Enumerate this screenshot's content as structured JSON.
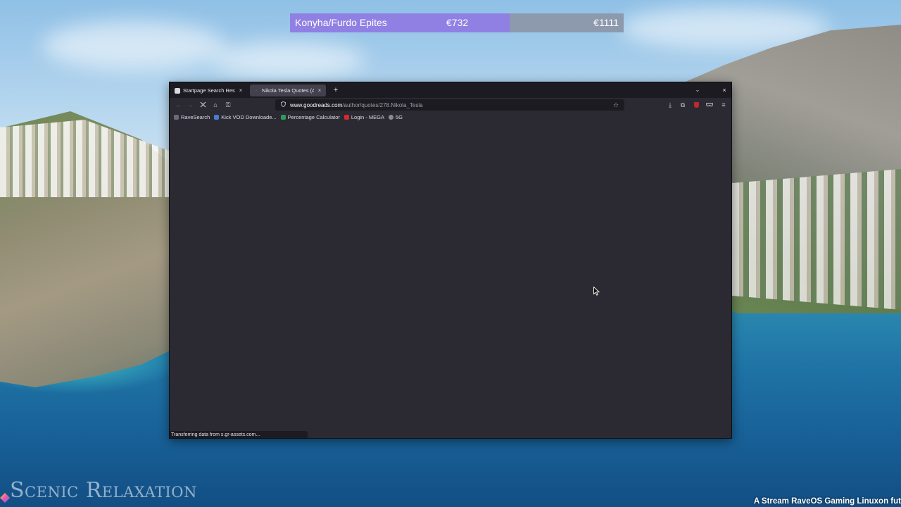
{
  "goal_bar": {
    "label": "Konyha/Furdo Epites",
    "current": "€732",
    "target": "€1111",
    "progress_fraction": 0.659,
    "fill_color": "#9080e4"
  },
  "browser": {
    "tabs": [
      {
        "title": "Startpage Search Results",
        "icon": "startpage-favicon",
        "active": false,
        "close": "×"
      },
      {
        "title": "Nikola Tesla Quotes (Author of My Inventions)",
        "icon": "loading-icon",
        "active": true,
        "close": "×"
      }
    ],
    "new_tab": "+",
    "list_tabs": "⌄",
    "close_window": "×",
    "nav": {
      "back": "←",
      "forward": "→",
      "home": "⌂",
      "permissions": "⚿",
      "star": "☆",
      "downloads": "⤓",
      "extensions": "⧉",
      "menu": "≡"
    },
    "url": {
      "host": "www.goodreads.com",
      "path": "/author/quotes/278.Nikola_Tesla"
    },
    "bookmarks": [
      {
        "label": "RaveSearch",
        "icon": "ravesearch-icon",
        "color": "#6b6b78"
      },
      {
        "label": "Kick VOD Downloade...",
        "icon": "kick-icon",
        "color": "#4a7ad8"
      },
      {
        "label": "Percentage Calculator",
        "icon": "percent-icon",
        "color": "#2e9b5d"
      },
      {
        "label": "Login - MEGA",
        "icon": "mega-icon",
        "color": "#d9272e"
      },
      {
        "label": "5G",
        "icon": "globe-icon",
        "color": "#8a8a96"
      }
    ],
    "status": "Transferring data from s.gr-assets.com..."
  },
  "overlay": {
    "watermark": "Scenic Relaxation",
    "ticker": "A Stream RaveOS Gaming Linuxon fut"
  }
}
